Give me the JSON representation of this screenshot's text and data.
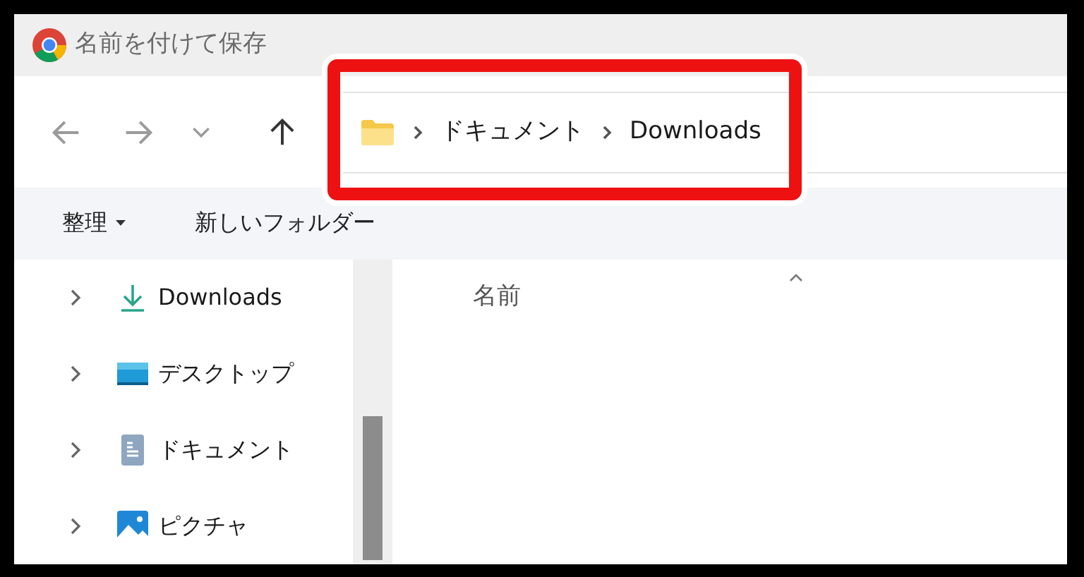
{
  "window": {
    "title": "名前を付けて保存"
  },
  "navigation": {
    "buttons": [
      {
        "kind": "back",
        "disabled": true
      },
      {
        "kind": "forward",
        "disabled": true
      },
      {
        "kind": "recent",
        "disabled": true
      },
      {
        "kind": "up",
        "disabled": false
      }
    ]
  },
  "address_bar": {
    "segments": [
      "ドキュメント",
      "Downloads"
    ]
  },
  "command_bar": {
    "items": [
      {
        "label": "整理",
        "dropdown": true
      },
      {
        "label": "新しいフォルダー",
        "dropdown": false
      }
    ]
  },
  "sidebar": {
    "items": [
      {
        "label": "Downloads",
        "kind": "downloads",
        "expanded": false
      },
      {
        "label": "デスクトップ",
        "kind": "desktop",
        "expanded": false
      },
      {
        "label": "ドキュメント",
        "kind": "documents",
        "expanded": false
      },
      {
        "label": "ピクチャ",
        "kind": "pictures",
        "expanded": false
      }
    ]
  },
  "file_list": {
    "columns": [
      {
        "label": "名前",
        "sorted": true
      }
    ]
  }
}
